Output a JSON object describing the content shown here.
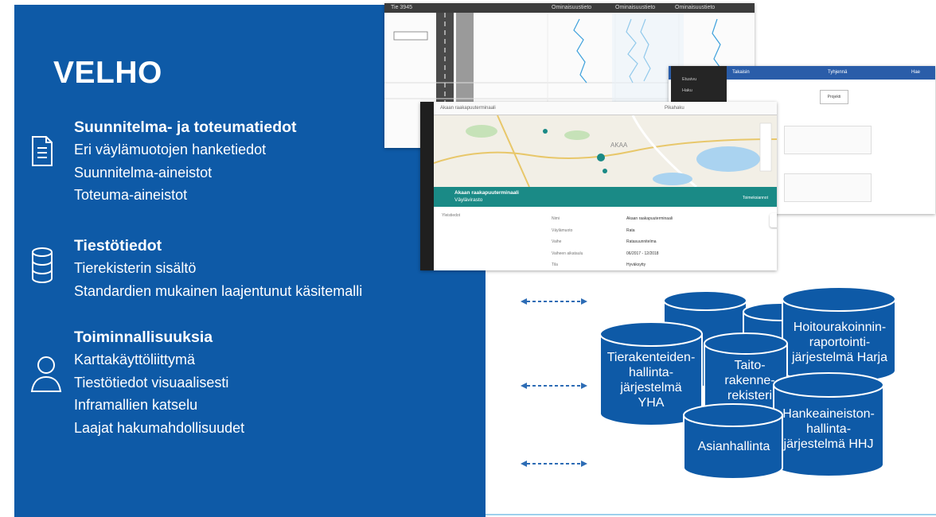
{
  "title": "VELHO",
  "sections": [
    {
      "heading": "Suunnitelma- ja toteumatiedot",
      "icon": "document-icon",
      "items": [
        "Eri väylämuotojen hanketiedot",
        "Suunnitelma-aineistot",
        "Toteuma-aineistot"
      ]
    },
    {
      "heading": "Tiestötiedot",
      "icon": "database-icon",
      "items": [
        "Tierekisterin sisältö",
        "Standardien mukainen laajentunut käsitemalli"
      ]
    },
    {
      "heading": "Toiminnallisuuksia",
      "icon": "user-icon",
      "items": [
        "Karttakäyttöliittymä",
        "Tiestötiedot visuaalisesti",
        "Inframallien katselu",
        "Laajat hakumahdollisuudet"
      ]
    }
  ],
  "screenshots": {
    "road_view": {
      "title": "Tie 3945",
      "tabs": [
        "Ominaisuustieto",
        "Ominaisuustieto",
        "Ominaisuustieto"
      ]
    },
    "project_view": {
      "back": "Takaisin",
      "clear": "Tyhjennä",
      "search": "Hae",
      "center_label": "Projekti"
    },
    "nav_menu": [
      "Etusivu",
      "Haku"
    ],
    "map_view": {
      "search_placeholder": "Akaan raakapuuterminaali",
      "tab": "Pikahaku",
      "city": "AKAA",
      "card_title": "Akaan raakapuuterminaali",
      "card_subtitle": "Väylävirasto",
      "card_action": "Toimeksiannot",
      "details_label": "Yleistiedot",
      "details": [
        {
          "key": "Nimi",
          "value": "Akaan raakapuuterminaali"
        },
        {
          "key": "Väylämuoto",
          "value": "Rata"
        },
        {
          "key": "Vaihe",
          "value": "Ratasuunnitelma"
        },
        {
          "key": "Vaiheen aikataulu",
          "value": "06/2017 - 12/2018"
        },
        {
          "key": "Tila",
          "value": "Hyväksytty"
        }
      ]
    }
  },
  "systems": {
    "yha": "Tierakenteiden-\nhallinta-\njärjestelmä\nYHA",
    "taito": "Taito-\nrakenne-\nrekisteri",
    "harja": "Hoitourakoinnin-\nraportointi-\njärjestelmä Harja",
    "hhj": "Hankeaineiston-\nhallinta-\njärjestelmä HHJ",
    "asianhallinta": "Asianhallinta"
  },
  "colors": {
    "panel_blue": "#0e5aa7",
    "cylinder_fill": "#0e5aa7",
    "cylinder_top": "#1a66b4",
    "teal": "#1a8a86",
    "arrow": "#2d6cb5"
  }
}
